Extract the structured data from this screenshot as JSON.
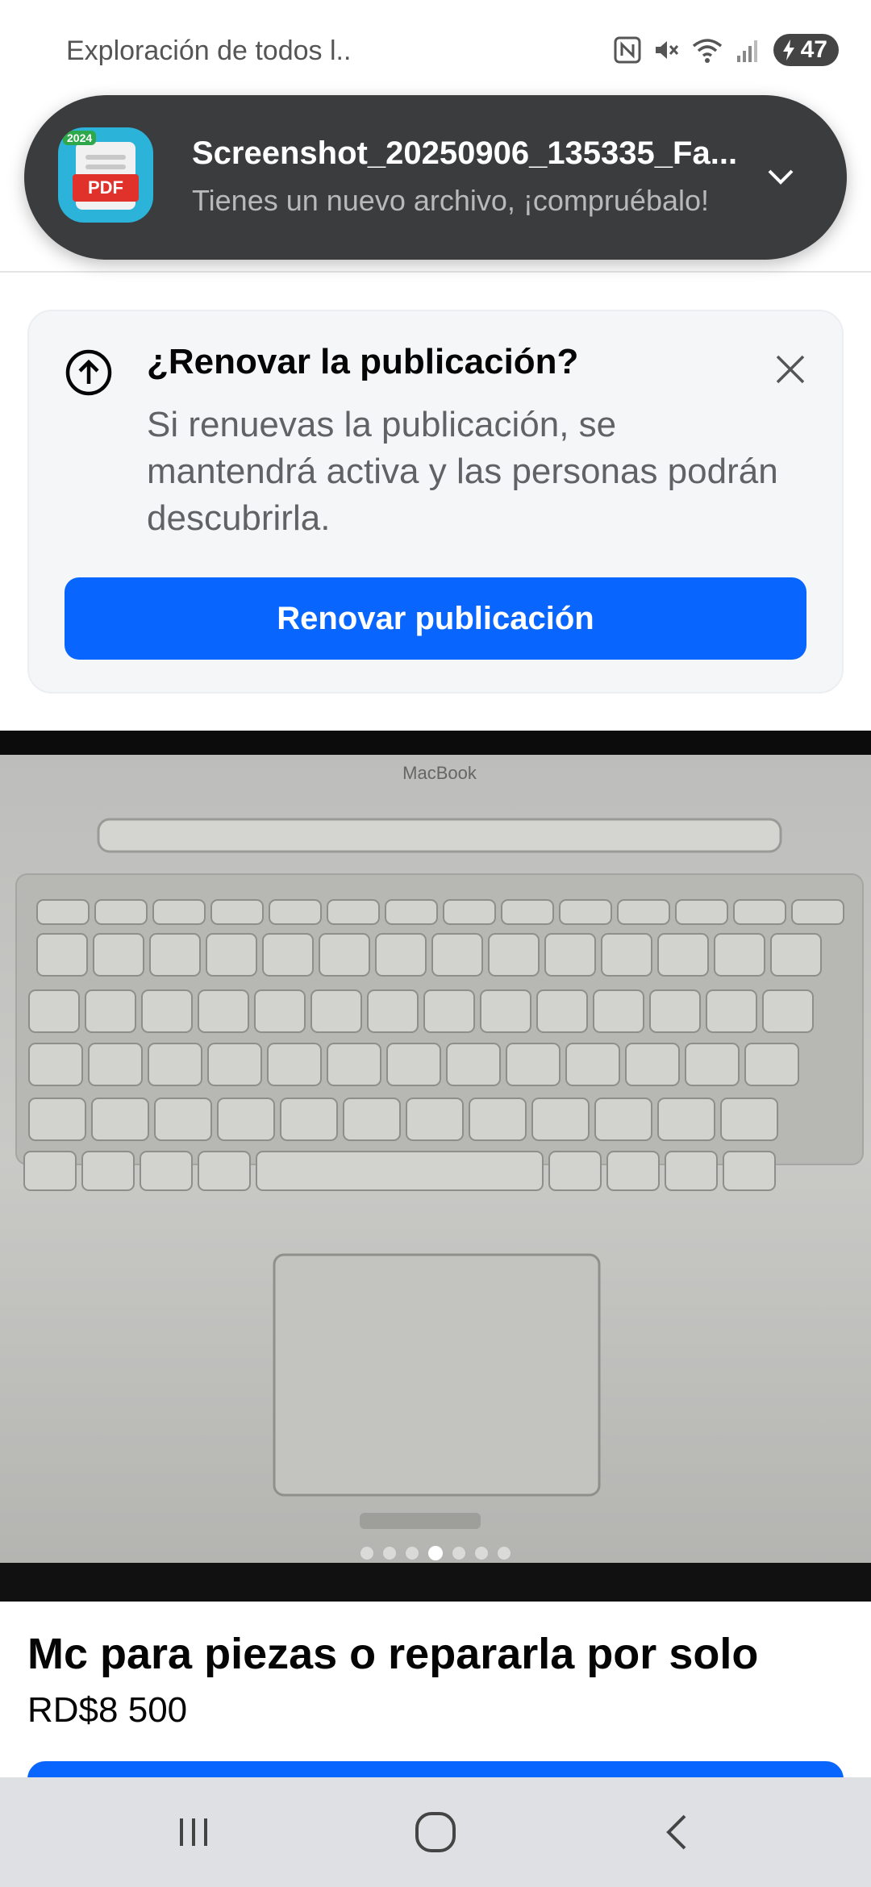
{
  "status_bar": {
    "text": "Exploración de todos l..",
    "battery": "47"
  },
  "header": {
    "close_glyph": "✕",
    "more_glyph": "···"
  },
  "notification": {
    "app_icon": "pdf-file-icon",
    "icon_year": "2024",
    "icon_tag": "PDF",
    "title": "Screenshot_20250906_135335_Fa...",
    "subtitle": "Tienes un nuevo archivo, ¡compruébalo!"
  },
  "renew_card": {
    "title": "¿Renovar la publicación?",
    "body": "Si renuevas la publicación, se mantendrá activa y las personas podrán descubrirla.",
    "button_label": "Renovar publicación"
  },
  "photo": {
    "brand_text": "MacBook",
    "carousel_count": 7,
    "carousel_active_index": 3
  },
  "listing": {
    "title": "Mc para piezas o repararla por solo",
    "price": "RD$8 500"
  },
  "colors": {
    "accent": "#0866ff",
    "notification_bg": "#3b3c3e",
    "card_bg": "#f5f6f8"
  }
}
